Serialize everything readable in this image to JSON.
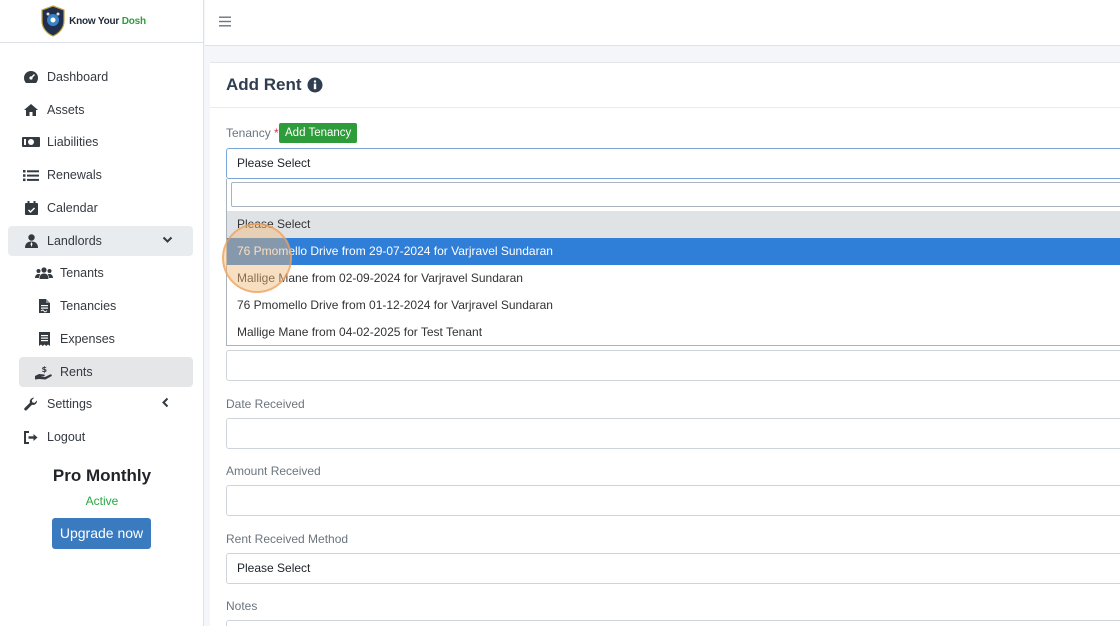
{
  "brand": {
    "name_part1": "Know Your ",
    "name_part2": "Dosh",
    "accent_color": "#2e9c3a"
  },
  "sidebar": {
    "items": [
      {
        "label": "Dashboard",
        "icon": "dashboard-icon"
      },
      {
        "label": "Assets",
        "icon": "home-icon"
      },
      {
        "label": "Liabilities",
        "icon": "money-bill-icon"
      },
      {
        "label": "Renewals",
        "icon": "list-icon"
      },
      {
        "label": "Calendar",
        "icon": "calendar-check-icon"
      },
      {
        "label": "Landlords",
        "icon": "user-tie-icon",
        "expanded": true
      },
      {
        "label": "Tenants",
        "icon": "users-icon"
      },
      {
        "label": "Tenancies",
        "icon": "file-contract-icon"
      },
      {
        "label": "Expenses",
        "icon": "receipt-icon"
      },
      {
        "label": "Rents",
        "icon": "hand-holding-usd-icon",
        "active": true
      },
      {
        "label": "Settings",
        "icon": "wrench-icon"
      },
      {
        "label": "Logout",
        "icon": "sign-out-icon"
      }
    ]
  },
  "plan": {
    "name": "Pro Monthly",
    "status": "Active",
    "upgrade_label": "Upgrade now",
    "status_color": "#28a745",
    "button_color": "#3a7abf"
  },
  "page": {
    "title": "Add Rent"
  },
  "form": {
    "tenancy_label": "Tenancy",
    "required_mark": "*",
    "add_tenancy_label": "Add Tenancy",
    "tenancy_selected": "Please Select",
    "dropdown_options": [
      {
        "label": "Please Select",
        "state": "disabled"
      },
      {
        "label": "76 Pmomello Drive from 29-07-2024 for Varjravel Sundaran",
        "state": "highlighted"
      },
      {
        "label": "Mallige Mane from 02-09-2024 for Varjravel Sundaran",
        "state": "normal"
      },
      {
        "label": "76 Pmomello Drive from 01-12-2024 for Varjravel Sundaran",
        "state": "normal"
      },
      {
        "label": "Mallige Mane from 04-02-2025 for Test Tenant",
        "state": "normal"
      }
    ],
    "date_received_label": "Date Received",
    "amount_received_label": "Amount Received",
    "method_label": "Rent Received Method",
    "method_selected": "Please Select",
    "notes_label": "Notes",
    "highlight_color": "#2f7ed8"
  }
}
